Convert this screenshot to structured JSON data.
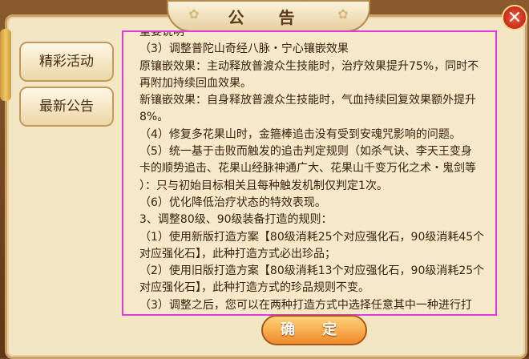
{
  "dialog": {
    "title": "公 告",
    "close_symbol": "✕"
  },
  "sidebar": {
    "items": [
      {
        "label": "精彩活动"
      },
      {
        "label": "最新公告"
      }
    ]
  },
  "content": {
    "lines": [
      "重要说明",
      "（3）调整普陀山奇经八脉・宁心镶嵌效果",
      "原镶嵌效果：主动释放普渡众生技能时，治疗效果提升75%，同时不",
      "再附加持续回血效果。",
      "新镶嵌效果：自身释放普渡众生技能时，气血持续回复效果额外提升",
      "8%。",
      "（4）修复多花果山时，金箍棒追击没有受到安魂咒影响的问题。",
      "（5）统一基于击败而触发的追击判定规则（如杀气诀、李天王变身",
      "卡的顺势追击、花果山经脉神通广大、花果山千变万化之术・鬼剑等",
      "）：只与初始目标相关且每种触发机制仅判定1次。",
      "（6）优化降低治疗状态的特效表现。",
      "3、调整80级、90级装备打造的规则：",
      "（1）使用新版打造方案【80级消耗25个对应强化石，90级消耗45个",
      "对应强化石】，此种打造方式必出珍品；",
      "（2）使用旧版打造方案【80级消耗13个对应强化石，90级消耗25个",
      "对应强化石】，此种打造方式的珍品规则不变。",
      "（3）调整之后，您可以在两种打造方式中选择任意其中一种进行打"
    ]
  },
  "footer": {
    "ok_label": "确 定"
  }
}
